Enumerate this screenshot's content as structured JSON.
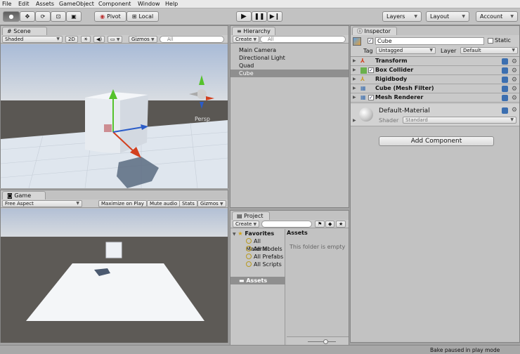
{
  "menubar": {
    "items": [
      "File",
      "Edit",
      "Assets",
      "GameObject",
      "Component",
      "Window",
      "Help"
    ]
  },
  "toolbar": {
    "pivot": "Pivot",
    "local": "Local",
    "layers": "Layers",
    "layout": "Layout",
    "account": "Account"
  },
  "scene": {
    "tab": "Scene",
    "shading": "Shaded",
    "mode2d": "2D",
    "gizmos": "Gizmos",
    "search_placeholder": "All",
    "persp": "Persp"
  },
  "game": {
    "tab": "Game",
    "aspect": "Free Aspect",
    "maximize": "Maximize on Play",
    "mute": "Mute audio",
    "stats": "Stats",
    "gizmos": "Gizmos"
  },
  "hierarchy": {
    "tab": "Hierarchy",
    "create": "Create",
    "search_placeholder": "All",
    "items": [
      "Main Camera",
      "Directional Light",
      "Quad",
      "Cube"
    ],
    "selected": "Cube"
  },
  "project": {
    "tab": "Project",
    "create": "Create",
    "favorites": "Favorites",
    "fav_items": [
      "All Material",
      "All Models",
      "All Prefabs",
      "All Scripts"
    ],
    "assets_root": "Assets",
    "assets_header": "Assets",
    "empty_msg": "This folder is empty"
  },
  "inspector": {
    "tab": "Inspector",
    "object_name": "Cube",
    "static_label": "Static",
    "tag_label": "Tag",
    "tag_value": "Untagged",
    "layer_label": "Layer",
    "layer_value": "Default",
    "components": [
      "Transform",
      "Box Collider",
      "Rigidbody",
      "Cube (Mesh Filter)",
      "Mesh Renderer"
    ],
    "material_name": "Default-Material",
    "shader_label": "Shader",
    "shader_value": "Standard",
    "add_component": "Add Component"
  },
  "statusbar": {
    "message": "Bake paused in play mode"
  },
  "colors": {
    "selection": "#8f8f8f",
    "sky_top": "#a9bbd7",
    "ground": "#5a5753",
    "accent": "#3c6fb0"
  }
}
